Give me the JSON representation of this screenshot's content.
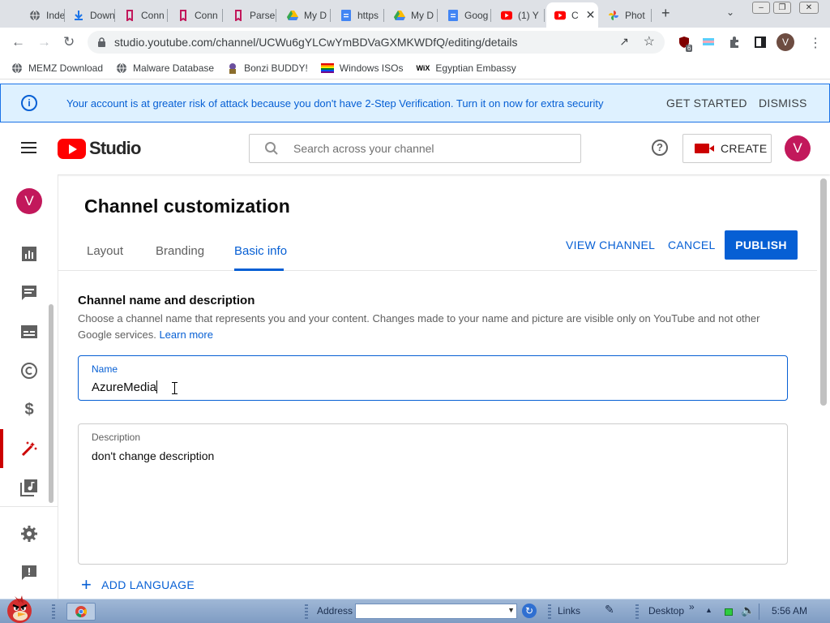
{
  "browser": {
    "tabs": [
      {
        "label": "Index",
        "icon": "globe-icon",
        "color": "#5f6368"
      },
      {
        "label": "Down",
        "icon": "download-icon",
        "color": "#1a73e8"
      },
      {
        "label": "Conn",
        "icon": "bracket-icon",
        "color": "#c2185b"
      },
      {
        "label": "Conn",
        "icon": "bracket-icon",
        "color": "#c2185b"
      },
      {
        "label": "Parse",
        "icon": "bracket-icon",
        "color": "#c2185b"
      },
      {
        "label": "My D",
        "icon": "drive-icon",
        "color": "#34a853"
      },
      {
        "label": "https",
        "icon": "docs-icon",
        "color": "#4285f4"
      },
      {
        "label": "My D",
        "icon": "drive-icon",
        "color": "#34a853"
      },
      {
        "label": "Goog",
        "icon": "docs-icon",
        "color": "#4285f4"
      },
      {
        "label": "(1) Y",
        "icon": "youtube-icon",
        "color": "#ff0000"
      },
      {
        "label": "C",
        "icon": "youtube-icon",
        "color": "#ff0000",
        "active": true
      },
      {
        "label": "Phot",
        "icon": "photos-icon",
        "color": "#fbbc04"
      }
    ],
    "url": "studio.youtube.com/channel/UCWu6gYLCwYmBDVaGXMKWDfQ/editing/details",
    "profile_initial": "V",
    "extension_badge": "6"
  },
  "bookmarks": [
    {
      "label": "MEMZ Download",
      "icon": "globe-icon"
    },
    {
      "label": "Malware Database",
      "icon": "globe-icon"
    },
    {
      "label": "Bonzi BUDDY!",
      "icon": "bonzi-icon"
    },
    {
      "label": "Windows ISOs",
      "icon": "rainbow-flag-icon"
    },
    {
      "label": "Egyptian Embassy",
      "icon": "wix-icon"
    }
  ],
  "banner": {
    "message": "Your account is at greater risk of attack because you don't have 2-Step Verification. Turn it on now for extra security",
    "get_started": "GET STARTED",
    "dismiss": "DISMISS"
  },
  "header": {
    "logo_text": "Studio",
    "search_placeholder": "Search across your channel",
    "create_label": "CREATE",
    "avatar_initial": "V"
  },
  "rail": {
    "avatar_initial": "V",
    "items": [
      "analytics-icon",
      "comments-icon",
      "subtitles-icon",
      "copyright-icon",
      "monetization-icon",
      "customization-icon",
      "audio-library-icon",
      "settings-icon",
      "feedback-icon"
    ],
    "active_index": 5
  },
  "page": {
    "title": "Channel customization",
    "tabs": [
      "Layout",
      "Branding",
      "Basic info"
    ],
    "active_tab": "Basic info",
    "view_channel": "VIEW CHANNEL",
    "cancel": "CANCEL",
    "publish": "PUBLISH"
  },
  "basic_info": {
    "section_title": "Channel name and description",
    "section_desc": "Choose a channel name that represents you and your content. Changes made to your name and picture are visible only on YouTube and not other Google services.",
    "learn_more": "Learn more",
    "name_label": "Name",
    "name_value": "AzureMedia",
    "description_label": "Description",
    "description_value": "don't change description",
    "add_language": "ADD LANGUAGE"
  },
  "taskbar": {
    "address_label": "Address",
    "links_label": "Links",
    "desktop_label": "Desktop",
    "clock": "5:56 AM"
  },
  "colors": {
    "accent": "#065fd4",
    "brand_red": "#ff0000",
    "banner_bg": "#def1ff",
    "avatar": "#c2185b"
  }
}
